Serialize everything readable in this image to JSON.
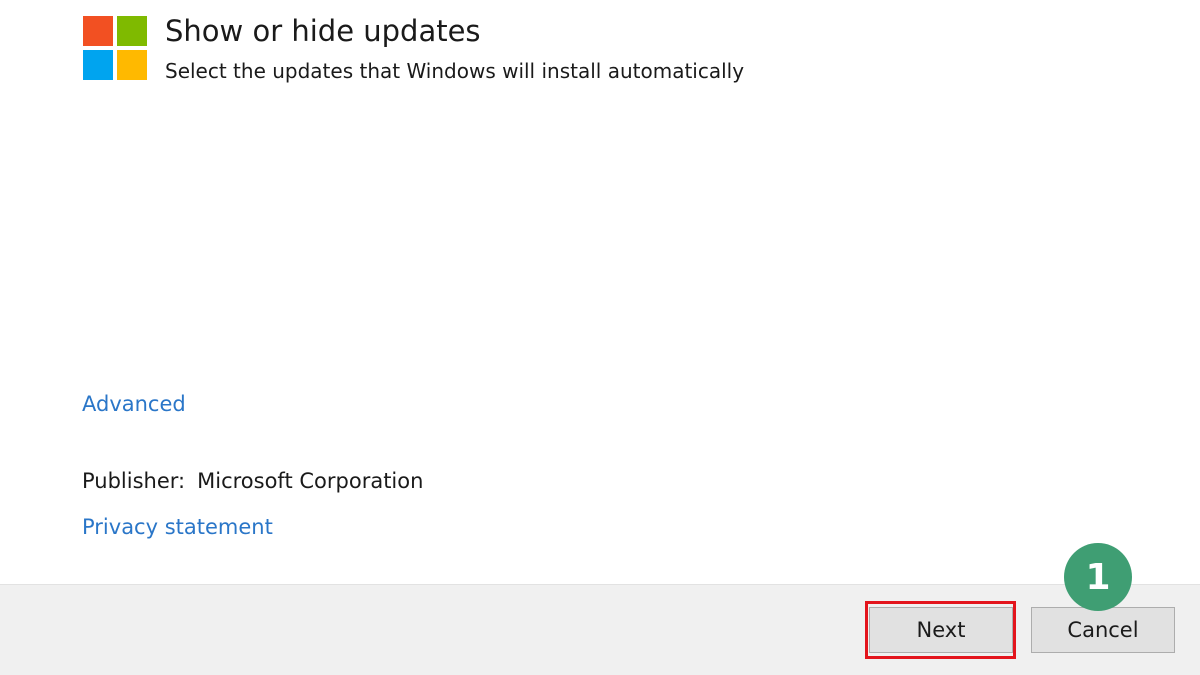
{
  "header": {
    "title": "Show or hide updates",
    "subtitle": "Select the updates that Windows will install automatically",
    "logo_icon": "windows-logo-icon"
  },
  "links": {
    "advanced": "Advanced",
    "privacy": "Privacy statement"
  },
  "publisher": {
    "label": "Publisher:",
    "value": "Microsoft Corporation"
  },
  "buttons": {
    "next": "Next",
    "cancel": "Cancel"
  },
  "annotation": {
    "step_number": "1",
    "badge_color": "#3f9e73",
    "highlight_color": "#e3141c"
  },
  "colors": {
    "logo_red": "#f25022",
    "logo_green": "#7fba00",
    "logo_blue": "#00a4ef",
    "logo_yellow": "#ffb900",
    "link": "#2a76c8"
  }
}
